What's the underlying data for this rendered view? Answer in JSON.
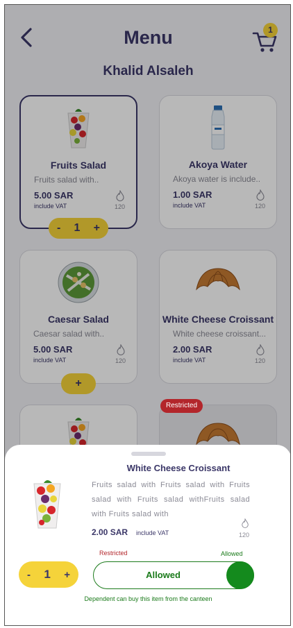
{
  "header": {
    "title": "Menu",
    "cart_count": "1"
  },
  "user_name": "Khalid Alsaleh",
  "cards": [
    {
      "name": "Fruits Salad",
      "desc": "Fruits salad with..",
      "price": "5.00 SAR",
      "vat": "include VAT",
      "calories": "120",
      "image": "fruit-cup",
      "qty": "1"
    },
    {
      "name": "Akoya Water",
      "desc": "Akoya water is include..",
      "price": "1.00 SAR",
      "vat": "include VAT",
      "calories": "120",
      "image": "water-bottle"
    },
    {
      "name": "Caesar Salad",
      "desc": "Caesar salad with..",
      "price": "5.00 SAR",
      "vat": "include VAT",
      "calories": "120",
      "image": "salad-bowl",
      "add": "+"
    },
    {
      "name": "White Cheese Croissant",
      "desc": "White cheese croissant...",
      "price": "2.00 SAR",
      "vat": "include VAT",
      "calories": "120",
      "image": "croissant"
    }
  ],
  "restricted_badge": "Restricted",
  "stepper": {
    "minus": "-",
    "plus": "+"
  },
  "sheet": {
    "name": "White Cheese Croissant",
    "desc": "Fruits salad with Fruits salad with Fruits salad with Fruits salad withFruits salad with Fruits salad with",
    "price": "2.00 SAR",
    "vat": "include VAT",
    "calories": "120",
    "qty": "1",
    "label_restricted": "Restricted",
    "label_allowed": "Allowed",
    "toggle_label": "Allowed",
    "note": "Dependent can buy this item from the canteen"
  },
  "colors": {
    "primary": "#3b3768",
    "accent": "#f5d33a",
    "allowed": "#148a1d",
    "restricted": "#b3262b"
  }
}
